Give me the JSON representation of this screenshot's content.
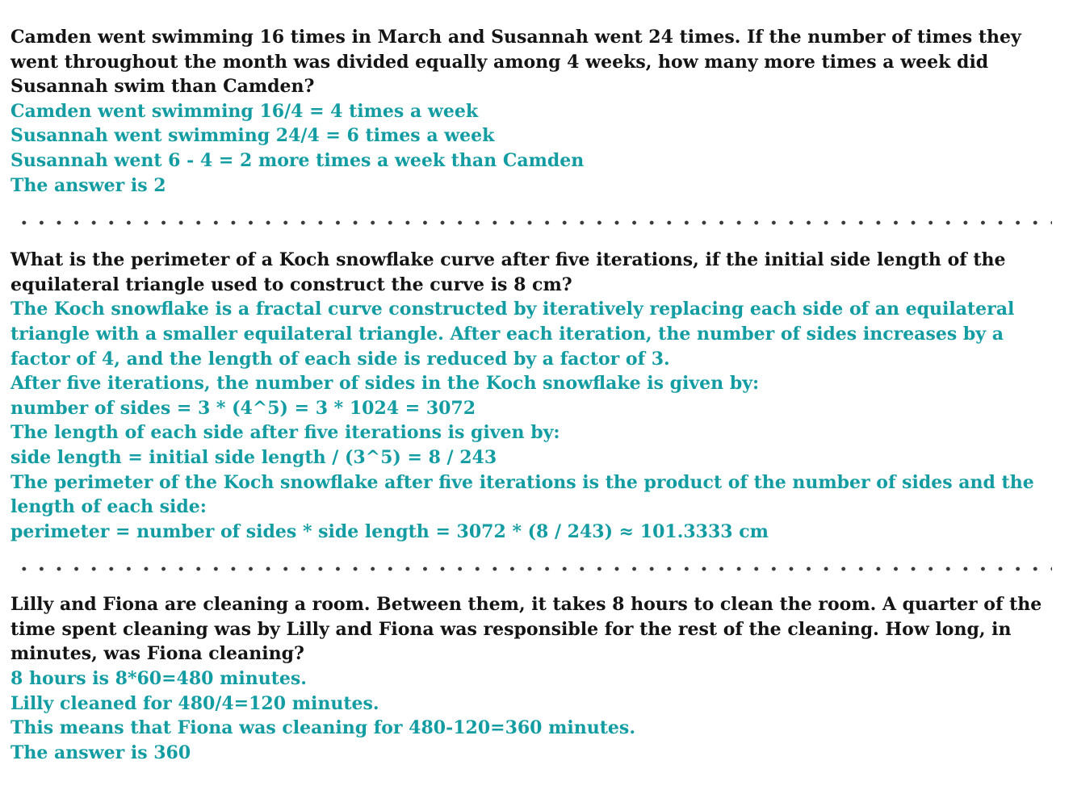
{
  "blocks": [
    {
      "question": "Camden went swimming 16 times in March and Susannah went 24 times. If the number of times they went throughout the month was divided equally among 4 weeks, how many more times a week did Susannah swim than Camden?",
      "answer_lines": [
        "Camden went swimming 16/4 = 4 times a week",
        "Susannah went swimming 24/4 = 6 times a week",
        "Susannah went 6 - 4 = 2 more times a week than Camden",
        "The answer is 2"
      ]
    },
    {
      "question": "What is the perimeter of a Koch snowflake curve after five iterations, if the initial side length of the equilateral triangle used to construct the curve is 8 cm?",
      "answer_lines": [
        "The Koch snowflake is a fractal curve constructed by iteratively replacing each side of an equilateral triangle with a smaller equilateral triangle. After each iteration, the number of sides increases by a factor of 4, and the length of each side is reduced by a factor of 3.",
        "After five iterations, the number of sides in the Koch snowflake is given by:",
        "number of sides = 3 * (4^5) = 3 * 1024 = 3072",
        "The length of each side after five iterations is given by:",
        "side length = initial side length / (3^5) = 8 / 243",
        "The perimeter of the Koch snowflake after five iterations is the product of the number of sides and the length of each side:",
        "perimeter = number of sides * side length = 3072 * (8 / 243) ≈ 101.3333 cm"
      ]
    },
    {
      "question": "Lilly and Fiona are cleaning a room. Between them, it takes 8 hours to clean the room. A quarter of the time spent cleaning was by Lilly and Fiona was responsible for the rest of the cleaning. How long, in minutes, was Fiona cleaning?",
      "answer_lines": [
        "8 hours is 8*60=480 minutes.",
        "Lilly cleaned for 480/4=120 minutes.",
        "This means that Fiona was cleaning for 480-120=360 minutes.",
        "The answer is 360"
      ]
    }
  ],
  "colors": {
    "question_text": "#141414",
    "answer_text": "#139da3",
    "separator_dots": "#3a3a3a",
    "background": "#ffffff"
  }
}
